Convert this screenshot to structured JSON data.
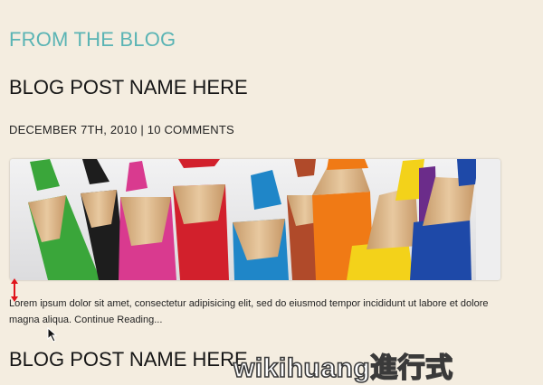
{
  "blog": {
    "section_title": "FROM THE BLOG",
    "posts": [
      {
        "title": "BLOG POST NAME HERE",
        "meta": "DECEMBER 7TH, 2010 | 10 COMMENTS",
        "excerpt": "Lorem ipsum dolor sit amet, consectetur adipisicing elit, sed do eiusmod tempor incididunt ut labore et dolore magna aliqua. ",
        "continue_label": "Continue Reading..."
      },
      {
        "title": "BLOG POST NAME HERE"
      }
    ]
  },
  "watermark": "wikihuang進行式",
  "colors": {
    "background": "#f4ede0",
    "section_title": "#5ab4b4",
    "text": "#1b1b1b",
    "resize_arrow": "#e0141b"
  },
  "icons": {
    "resize_handle": "vertical-double-arrow-icon",
    "cursor": "mouse-pointer-icon"
  }
}
